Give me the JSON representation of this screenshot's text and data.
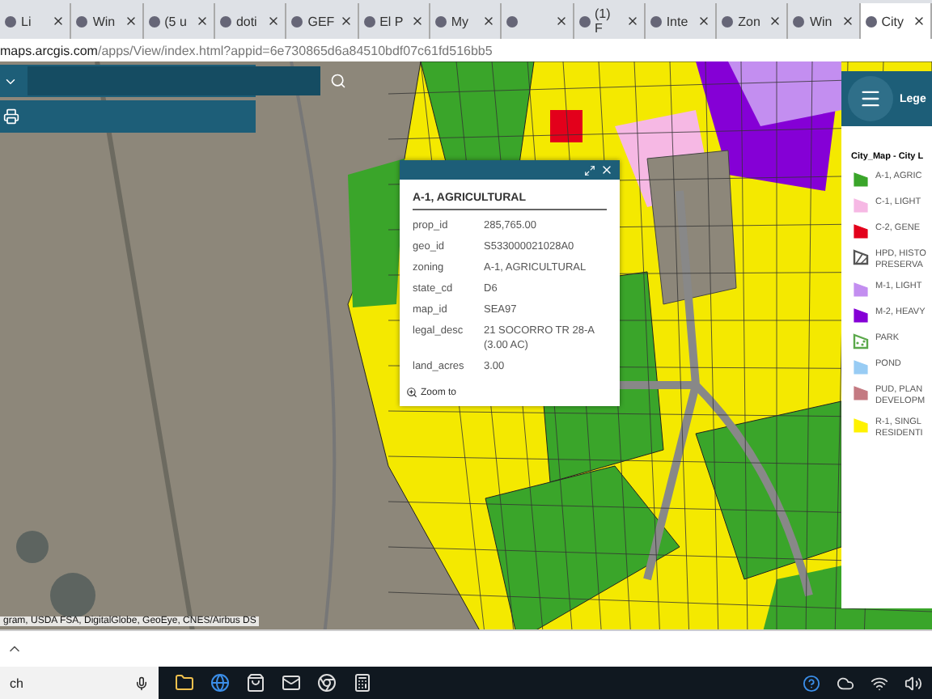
{
  "tabs": [
    {
      "label": "Li",
      "selected": false
    },
    {
      "label": "Win",
      "selected": false
    },
    {
      "label": "(5 u",
      "selected": false
    },
    {
      "label": "doti",
      "selected": false
    },
    {
      "label": "GEF",
      "selected": false
    },
    {
      "label": "El P",
      "selected": false
    },
    {
      "label": "My",
      "selected": false
    },
    {
      "selected": false
    },
    {
      "label": "(1) F",
      "selected": false
    },
    {
      "label": "Inte",
      "selected": false
    },
    {
      "label": "Zon",
      "selected": false
    },
    {
      "label": "Win",
      "selected": false
    },
    {
      "label": "City",
      "selected": true
    }
  ],
  "address": {
    "host": "maps.arcgis.com",
    "path": "/apps/View/index.html?appid=6e730865d6a84510bdf07c61fd516bb5"
  },
  "popup": {
    "title": "A-1, AGRICULTURAL",
    "fields": [
      {
        "name": "prop_id",
        "value": "285,765.00"
      },
      {
        "name": "geo_id",
        "value": "S533000021028A0"
      },
      {
        "name": "zoning",
        "value": "A-1, AGRICULTURAL"
      },
      {
        "name": "state_cd",
        "value": "D6"
      },
      {
        "name": "map_id",
        "value": "SEA97"
      },
      {
        "name": "legal_desc",
        "value": "21 SOCORRO TR 28-A (3.00 AC)"
      },
      {
        "name": "land_acres",
        "value": "3.00"
      }
    ],
    "link": "Zoom to"
  },
  "legend": {
    "title": "Lege",
    "layer": "City_Map - City L",
    "items": [
      {
        "label": "A-1, AGRIC",
        "kind": "fill",
        "color": "#3aa52a"
      },
      {
        "label": "C-1, LIGHT",
        "kind": "fill",
        "color": "#f6b8e4"
      },
      {
        "label": "C-2, GENE",
        "kind": "fill",
        "color": "#e3001b"
      },
      {
        "label": "HPD, HISTO PRESERVA",
        "kind": "hatch",
        "color": "#555555"
      },
      {
        "label": "M-1, LIGHT",
        "kind": "fill",
        "color": "#c38ef0"
      },
      {
        "label": "M-2, HEAVY",
        "kind": "fill",
        "color": "#8500d6"
      },
      {
        "label": "PARK",
        "kind": "dots",
        "color": "#5aa84a"
      },
      {
        "label": "POND",
        "kind": "fill",
        "color": "#98ccf4"
      },
      {
        "label": "PUD, PLAN DEVELOPM",
        "kind": "fill",
        "color": "#c47a82"
      },
      {
        "label": "R-1, SINGL RESIDENTI",
        "kind": "fill",
        "color": "#fff200"
      }
    ]
  },
  "attribution": "gram, USDA FSA, DigitalGlobe, GeoEye, CNES/Airbus DS",
  "taskbar": {
    "search": "ch"
  }
}
